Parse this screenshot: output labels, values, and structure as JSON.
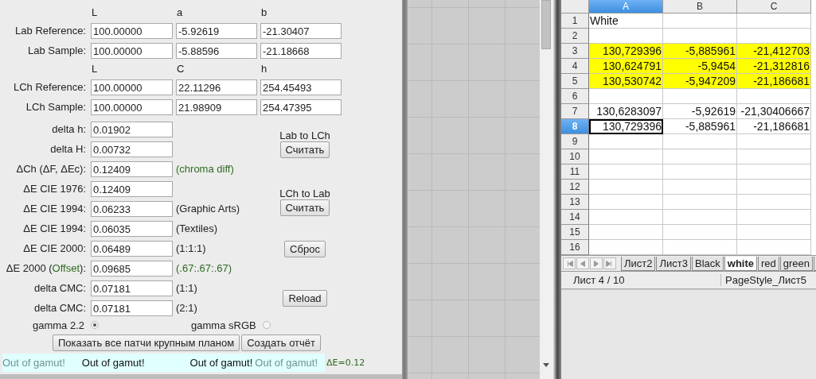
{
  "lab": {
    "headers": [
      "L",
      "a",
      "b"
    ],
    "rows": [
      {
        "label": "Lab Reference:",
        "values": [
          "100.00000",
          "-5.92619",
          "-21.30407"
        ]
      },
      {
        "label": "Lab Sample:",
        "values": [
          "100.00000",
          "-5.88596",
          "-21.18668"
        ]
      }
    ]
  },
  "lch": {
    "headers": [
      "L",
      "C",
      "h"
    ],
    "rows": [
      {
        "label": "LCh Reference:",
        "values": [
          "100.00000",
          "22.11296",
          "254.45493"
        ]
      },
      {
        "label": "LCh Sample:",
        "values": [
          "100.00000",
          "21.98909",
          "254.47395"
        ]
      }
    ]
  },
  "deltas": [
    {
      "label": [
        {
          "text": "delta h:"
        }
      ],
      "value": "0.01902"
    },
    {
      "label": [
        {
          "text": "delta H:"
        }
      ],
      "value": "0.00732"
    },
    {
      "label": [
        {
          "text": "ΔCh (ΔF, ΔEc):"
        }
      ],
      "value": "0.12409",
      "note": "(chroma diff)",
      "note_accent": true
    },
    {
      "label": [
        {
          "text": "ΔE CIE 1976:"
        }
      ],
      "value": "0.12409"
    },
    {
      "label": [
        {
          "text": "ΔE CIE 1994:"
        }
      ],
      "value": "0.06233",
      "note": "(Graphic Arts)",
      "note_accent": false
    },
    {
      "label": [
        {
          "text": "ΔE CIE 1994:"
        }
      ],
      "value": "0.06035",
      "note": "(Textiles)",
      "note_accent": false
    },
    {
      "label": [
        {
          "text": "ΔE CIE 2000:"
        }
      ],
      "value": "0.06489",
      "note": "(1:1:1)",
      "note_accent": false
    },
    {
      "label": [
        {
          "text": "ΔE 2000 ("
        },
        {
          "text": "Offset",
          "accent": true
        },
        {
          "text": "):"
        }
      ],
      "value": "0.09685",
      "note": "(.67:.67:.67)",
      "note_accent": true
    },
    {
      "label": [
        {
          "text": "delta CMC:"
        }
      ],
      "value": "0.07181",
      "note": "(1:1)",
      "note_accent": false
    },
    {
      "label": [
        {
          "text": "delta CMC:"
        }
      ],
      "value": "0.07181",
      "note": "(2:1)",
      "note_accent": false
    }
  ],
  "actions": [
    {
      "caption": "Lab to LCh",
      "button": "Считать"
    },
    {
      "caption": "LCh to Lab",
      "button": "Считать"
    },
    {
      "button": "Сброс"
    },
    {
      "button": "Reload"
    }
  ],
  "gamma": [
    {
      "label": "gamma 2.2",
      "selected": true
    },
    {
      "label": "gamma sRGB",
      "selected": false
    }
  ],
  "buttons": [
    "Показать все патчи крупным планом",
    "Создать отчёт"
  ],
  "gamut": [
    {
      "text": "Out of gamut!",
      "active": false
    },
    {
      "text": "Out of gamut!",
      "active": true
    },
    {
      "text": "Out of gamut!",
      "active": true
    },
    {
      "text": "Out of gamut!",
      "active": false
    }
  ],
  "delta_e": "ΔE=0.12",
  "sheet": {
    "columns": [
      {
        "label": "A",
        "selected": true
      },
      {
        "label": "B",
        "selected": false
      },
      {
        "label": "C",
        "selected": false
      }
    ],
    "rows": [
      {
        "num": "1",
        "selected": false,
        "kind": "text",
        "cells": [
          "White"
        ]
      },
      {
        "num": "2",
        "selected": false
      },
      {
        "num": "3",
        "selected": false,
        "kind": "number",
        "highlight": true,
        "cells": [
          "130,729396",
          "-5,885961",
          "-21,412703"
        ]
      },
      {
        "num": "4",
        "selected": false,
        "kind": "number",
        "highlight": true,
        "cells": [
          "130,624791",
          "-5,9454",
          "-21,312816"
        ]
      },
      {
        "num": "5",
        "selected": false,
        "kind": "number",
        "highlight": true,
        "cells": [
          "130,530742",
          "-5,947209",
          "-21,186681"
        ]
      },
      {
        "num": "6",
        "selected": false
      },
      {
        "num": "7",
        "selected": false,
        "kind": "number",
        "cells": [
          "130,6283097",
          "-5,92619",
          "-21,30406667"
        ]
      },
      {
        "num": "8",
        "selected": true,
        "kind": "number",
        "cells": [
          "130,729396",
          "-5,885961",
          "-21,186681"
        ]
      },
      {
        "num": "9",
        "selected": false
      },
      {
        "num": "10",
        "selected": false
      },
      {
        "num": "11",
        "selected": false
      },
      {
        "num": "12",
        "selected": false
      },
      {
        "num": "13",
        "selected": false
      },
      {
        "num": "14",
        "selected": false
      },
      {
        "num": "15",
        "selected": false
      },
      {
        "num": "16",
        "selected": false
      }
    ],
    "tabs": [
      {
        "label": "Лист2",
        "selected": false
      },
      {
        "label": "Лист3",
        "selected": false
      },
      {
        "label": "Black",
        "selected": false
      },
      {
        "label": "white",
        "selected": true
      },
      {
        "label": "red",
        "selected": false
      },
      {
        "label": "green",
        "selected": false
      }
    ],
    "status": [
      "Лист 4 / 10",
      "PageStyle_Лист5"
    ]
  }
}
